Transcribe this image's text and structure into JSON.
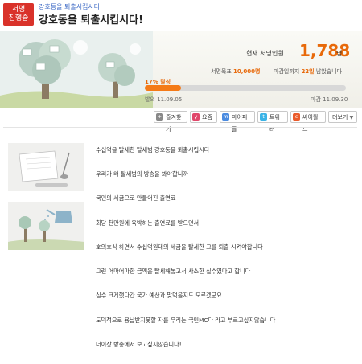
{
  "header": {
    "badge_line1": "서명",
    "badge_line2": "진행중",
    "breadcrumb": "강호동을 퇴출시킵시다",
    "title": "강호동을 퇴출시킵시다!"
  },
  "stats": {
    "current_label": "현재 서명인원",
    "current_count": "1,788",
    "current_unit": "명",
    "goal_label": "서명목표",
    "goal_value": "10,000명",
    "days_label": "마감일까지",
    "days_value": "22일",
    "days_suffix": "남았습니다",
    "progress_text": "17% 달성",
    "progress_fraction": 0.1788,
    "start_label": "발의",
    "start_date": "11.09.05",
    "end_label": "마감",
    "end_date": "11.09.30"
  },
  "share": [
    {
      "label": "즐겨찾기",
      "icon": "plus-icon",
      "color": "#888888"
    },
    {
      "label": "요즘",
      "icon": "yozm-icon",
      "color": "#e0476a"
    },
    {
      "label": "마이피플",
      "icon": "mypeople-icon",
      "color": "#4a8be0"
    },
    {
      "label": "트위터",
      "icon": "twitter-icon",
      "color": "#3ab3e6"
    },
    {
      "label": "싸이월드",
      "icon": "cyworld-icon",
      "color": "#ea5a2a"
    },
    {
      "label": "더보기",
      "icon": "chevron-down-icon",
      "color": "#ffffff"
    }
  ],
  "body_lines": [
    "수십억을 탈세한 탈세범 강호동을 퇴출시킵시다",
    "우리가 왜 탈세범의 방송을 봐야합니까",
    "국민의 세금으로 만들어진 출연료",
    "회당 천만원에 육박하는 출연료를 받으면서",
    "호의호식 하면서 수십억원대의 세금을 탈세한 그를 퇴출 시켜야합니다",
    "그런 어마어마한 금액을 탈세해놓고서 사소한 실수였다고 합니다",
    "실수 크게했다간 국가 예산과 맞먹을지도 모르겠군요",
    "도덕적으로 용납받지못할 자를 우리는 국민MC다 라고 부르고싶지않습니다",
    "더이상 방송에서 보고싶지않습니다!"
  ],
  "colors": {
    "accent": "#e8690a",
    "badge": "#d9322a",
    "progress": "#f47a17"
  }
}
